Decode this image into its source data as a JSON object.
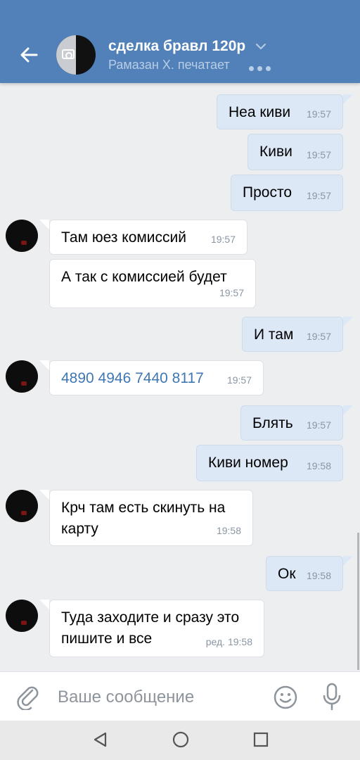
{
  "header": {
    "back_icon": "arrow-left-icon",
    "title": "сделка бравл 120р",
    "status": "Рамазан Х. печатает",
    "chevron_icon": "chevron-down-icon",
    "color": "#5181b8"
  },
  "messages": [
    {
      "dir": "out",
      "text": "Неа киви",
      "time": "19:57"
    },
    {
      "dir": "out",
      "text": "Киви",
      "time": "19:57"
    },
    {
      "dir": "out",
      "text": "Просто",
      "time": "19:57"
    },
    {
      "dir": "in",
      "text": "Там юез комиссий",
      "time": "19:57"
    },
    {
      "dir": "in",
      "text": "А так с комиссией будет",
      "time": "19:57"
    },
    {
      "dir": "out",
      "text": "И там",
      "time": "19:57"
    },
    {
      "dir": "in",
      "text": "4890 4946 7440 8117",
      "time": "19:57",
      "link": true
    },
    {
      "dir": "out",
      "text": "Блять",
      "time": "19:57"
    },
    {
      "dir": "out",
      "text": "Киви номер",
      "time": "19:58"
    },
    {
      "dir": "in",
      "text": "Крч там есть скинуть на\nкарту",
      "time": "19:58"
    },
    {
      "dir": "out",
      "text": "Ок",
      "time": "19:58"
    },
    {
      "dir": "in",
      "text": "Туда заходите и сразу это\nпишите и все",
      "time": "ред. 19:58"
    }
  ],
  "composer": {
    "placeholder": "Ваше сообщение",
    "attach_icon": "paperclip-icon",
    "emoji_icon": "smile-icon",
    "mic_icon": "microphone-icon"
  },
  "navbar": {
    "back_icon": "nav-back-triangle-icon",
    "home_icon": "nav-home-circle-icon",
    "recent_icon": "nav-recent-square-icon"
  },
  "colors": {
    "outgoing_bubble": "#dce8f6",
    "incoming_bubble": "#ffffff",
    "background": "#edeef0",
    "link": "#3f77b4"
  }
}
